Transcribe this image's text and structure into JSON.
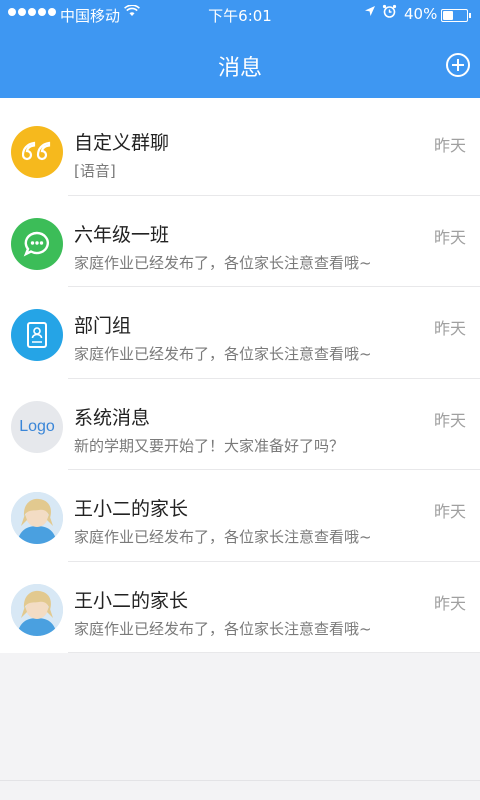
{
  "status_bar": {
    "carrier": "中国移动",
    "time": "下午6:01",
    "battery_text": "40%",
    "battery_level": 0.4,
    "signal_bars": 5,
    "icons": [
      "wifi-icon",
      "location-icon",
      "alarm-icon",
      "battery-icon"
    ]
  },
  "header": {
    "title": "消息",
    "add_icon": "add-circle-icon"
  },
  "colors": {
    "header_bg": "#3e97f2",
    "yellow": "#f6b91d",
    "green": "#3cbd58",
    "blue": "#25a4e6",
    "logo_bg": "#e6e8ec"
  },
  "conversations": [
    {
      "name": "自定义群聊",
      "preview": "[语音]",
      "time": "昨天",
      "avatar": "quote-icon"
    },
    {
      "name": "六年级一班",
      "preview": "家庭作业已经发布了，各位家长注意查看哦~",
      "time": "昨天",
      "avatar": "chat-bubble-icon"
    },
    {
      "name": "部门组",
      "preview": "家庭作业已经发布了，各位家长注意查看哦~",
      "time": "昨天",
      "avatar": "id-card-icon"
    },
    {
      "name": "系统消息",
      "preview": "新的学期又要开始了！大家准备好了吗？",
      "time": "昨天",
      "avatar": "logo",
      "avatar_text": "Logo"
    },
    {
      "name": "王小二的家长",
      "preview": "家庭作业已经发布了，各位家长注意查看哦~",
      "time": "昨天",
      "avatar": "user-photo"
    },
    {
      "name": "王小二的家长",
      "preview": "家庭作业已经发布了，各位家长注意查看哦~",
      "time": "昨天",
      "avatar": "user-photo"
    }
  ]
}
